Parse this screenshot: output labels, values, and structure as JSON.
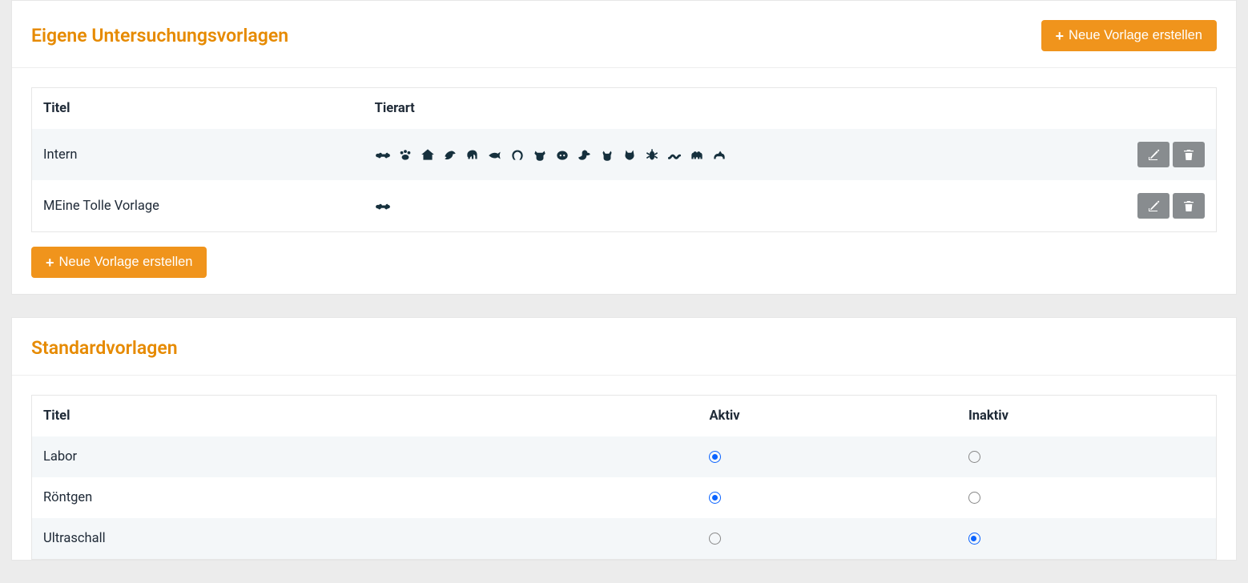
{
  "section1": {
    "title": "Eigene Untersuchungsvorlagen",
    "new_button_label": "Neue Vorlage erstellen",
    "columns": {
      "titel": "Titel",
      "tierart": "Tierart"
    },
    "rows": [
      {
        "titel": "Intern",
        "species": [
          "bone",
          "paw",
          "house",
          "bird",
          "elephant",
          "fish",
          "horseshoe",
          "cow",
          "pig",
          "duck",
          "goat",
          "cat",
          "bug",
          "snake",
          "camel",
          "dog-small"
        ]
      },
      {
        "titel": "MEine Tolle Vorlage",
        "species": [
          "bone"
        ]
      }
    ]
  },
  "section2": {
    "title": "Standardvorlagen",
    "columns": {
      "titel": "Titel",
      "aktiv": "Aktiv",
      "inaktiv": "Inaktiv"
    },
    "rows": [
      {
        "titel": "Labor",
        "state": "aktiv"
      },
      {
        "titel": "Röntgen",
        "state": "aktiv"
      },
      {
        "titel": "Ultraschall",
        "state": "inaktiv"
      }
    ]
  }
}
